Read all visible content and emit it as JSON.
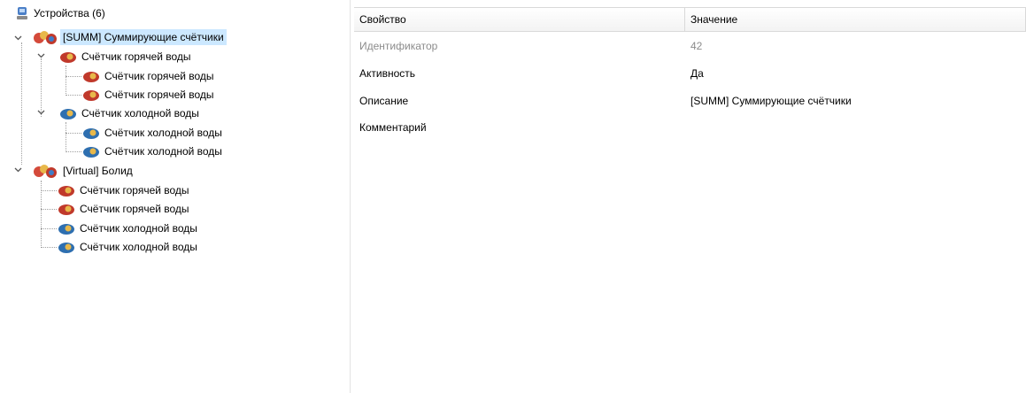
{
  "tree": {
    "root": {
      "label": "Устройства (6)",
      "icon": "devices-root-icon"
    },
    "groups": [
      {
        "label": "[SUMM] Суммирующие счётчики",
        "icon": "summ-group-icon",
        "expanded": true,
        "selected": true,
        "children": [
          {
            "label": "Счётчик горячей воды",
            "icon": "hot-water-meter-icon",
            "expanded": true,
            "children": [
              {
                "label": "Счётчик горячей воды",
                "icon": "hot-water-meter-icon"
              },
              {
                "label": "Счётчик горячей воды",
                "icon": "hot-water-meter-icon"
              }
            ]
          },
          {
            "label": "Счётчик холодной воды",
            "icon": "cold-water-meter-icon",
            "expanded": true,
            "children": [
              {
                "label": "Счётчик холодной воды",
                "icon": "cold-water-meter-icon"
              },
              {
                "label": "Счётчик холодной воды",
                "icon": "cold-water-meter-icon"
              }
            ]
          }
        ]
      },
      {
        "label": "[Virtual] Болид",
        "icon": "virtual-group-icon",
        "expanded": true,
        "children": [
          {
            "label": "Счётчик горячей воды",
            "icon": "hot-water-meter-icon"
          },
          {
            "label": "Счётчик горячей воды",
            "icon": "hot-water-meter-icon"
          },
          {
            "label": "Счётчик холодной воды",
            "icon": "cold-water-meter-icon"
          },
          {
            "label": "Счётчик холодной воды",
            "icon": "cold-water-meter-icon"
          }
        ]
      }
    ]
  },
  "properties": {
    "headers": {
      "property": "Свойство",
      "value": "Значение"
    },
    "rows": [
      {
        "name": "Идентификатор",
        "value": "42",
        "disabled": true
      },
      {
        "name": "Активность",
        "value": "Да",
        "disabled": false
      },
      {
        "name": "Описание",
        "value": "[SUMM] Суммирующие счётчики",
        "disabled": false
      },
      {
        "name": "Комментарий",
        "value": "",
        "disabled": false
      }
    ]
  },
  "colors": {
    "selection": "#cce8ff",
    "disabled_text": "#8c8c8c",
    "hot_water": "#c0392b",
    "cold_water": "#2e6fb0",
    "summ_group": "#d44a3a"
  }
}
